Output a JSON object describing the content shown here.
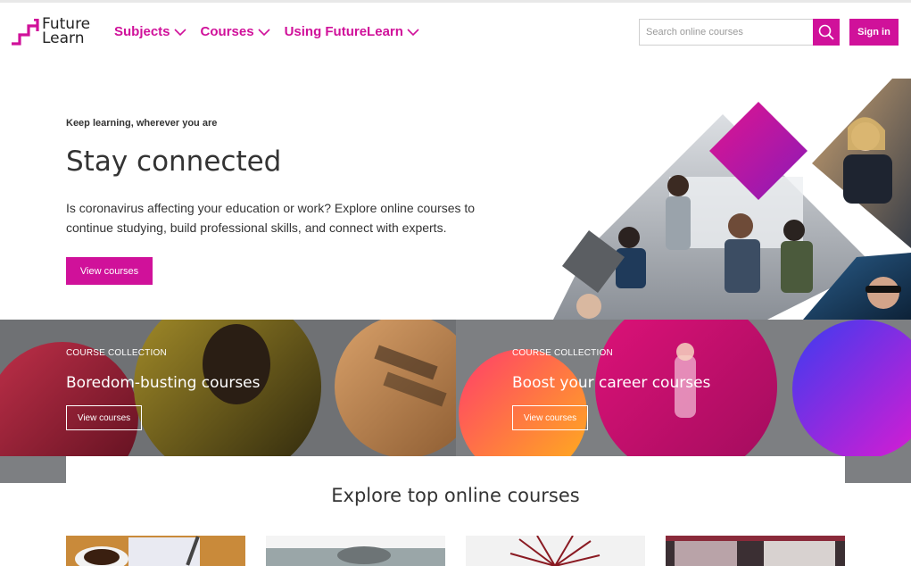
{
  "brand": {
    "logo_line1": "Future",
    "logo_line2": "Learn",
    "accent": "#d0119a"
  },
  "nav": {
    "items": [
      {
        "label": "Subjects",
        "icon": "chevron-down-icon"
      },
      {
        "label": "Courses",
        "icon": "chevron-down-icon"
      },
      {
        "label": "Using FutureLearn",
        "icon": "chevron-down-icon"
      }
    ]
  },
  "search": {
    "placeholder": "Search online courses",
    "value": "",
    "icon": "search-icon"
  },
  "signin": {
    "label": "Sign in"
  },
  "hero": {
    "eyebrow": "Keep learning, wherever you are",
    "title": "Stay connected",
    "description": "Is coronavirus affecting your education or work? Explore online courses to continue studying, build professional skills, and connect with experts.",
    "button": "View courses"
  },
  "collections": [
    {
      "eyebrow": "COURSE COLLECTION",
      "title": "Boredom-busting courses",
      "button": "View courses"
    },
    {
      "eyebrow": "COURSE COLLECTION",
      "title": "Boost your career courses",
      "button": "View courses"
    }
  ],
  "explore": {
    "title": "Explore top online courses"
  }
}
